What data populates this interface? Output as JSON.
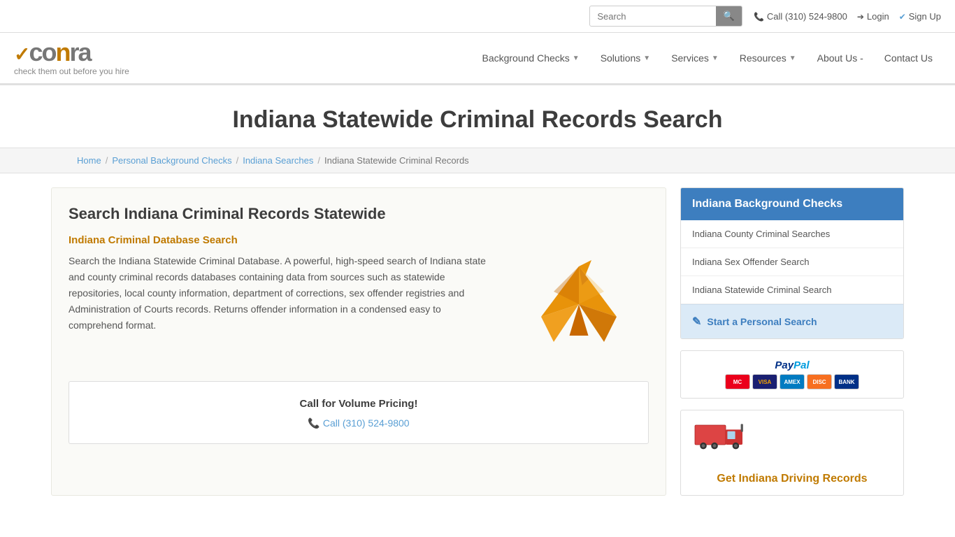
{
  "topbar": {
    "search_placeholder": "Search",
    "call_label": "Call (310) 524-9800",
    "login_label": "Login",
    "signup_label": "Sign Up"
  },
  "nav": {
    "logo_tagline": "check them out before you hire",
    "items": [
      {
        "label": "Background Checks",
        "has_dropdown": true
      },
      {
        "label": "Solutions",
        "has_dropdown": true
      },
      {
        "label": "Services",
        "has_dropdown": true
      },
      {
        "label": "Resources",
        "has_dropdown": true
      },
      {
        "label": "About Us -",
        "has_dropdown": false
      },
      {
        "label": "Contact Us",
        "has_dropdown": false
      }
    ]
  },
  "page": {
    "title": "Indiana Statewide Criminal Records Search"
  },
  "breadcrumb": {
    "home": "Home",
    "personal": "Personal Background Checks",
    "indiana": "Indiana Searches",
    "current": "Indiana Statewide Criminal Records"
  },
  "content": {
    "heading": "Search Indiana Criminal Records Statewide",
    "subheading": "Indiana Criminal Database Search",
    "body": "Search the Indiana Statewide Criminal Database. A powerful, high-speed search of Indiana state and county criminal records databases containing data from sources such as statewide repositories, local county information, department of corrections, sex offender registries and Administration of Courts records. Returns offender information in a condensed easy to comprehend format.",
    "call_box": {
      "title": "Call for Volume Pricing!",
      "phone_label": "Call (310) 524-9800"
    }
  },
  "sidebar": {
    "header": "Indiana Background Checks",
    "menu_items": [
      "Indiana County Criminal Searches",
      "Indiana Sex Offender Search",
      "Indiana Statewide Criminal Search"
    ],
    "cta_label": "Start a Personal Search"
  },
  "paypal": {
    "text": "PayPal",
    "cards": [
      "MC",
      "VISA",
      "AMEX",
      "DISC",
      "BANK"
    ]
  },
  "driving": {
    "title": "Get Indiana Driving Records"
  }
}
